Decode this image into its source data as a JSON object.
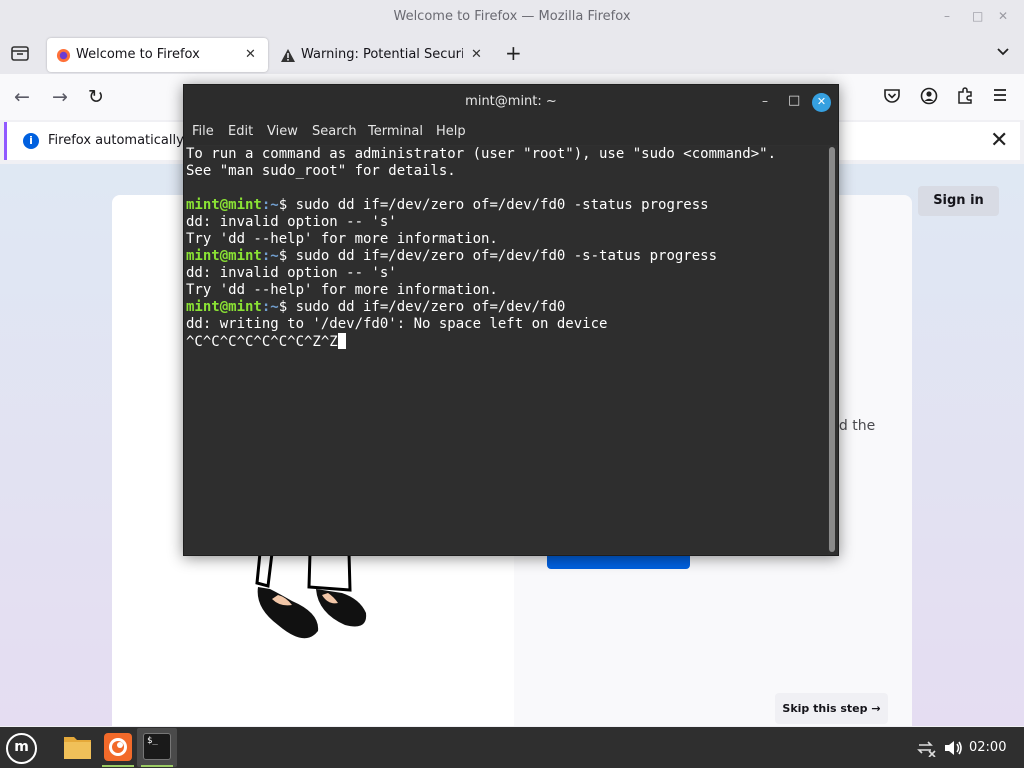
{
  "firefox": {
    "window_title": "Welcome to Firefox — Mozilla Firefox",
    "window_controls": {
      "minimize": "–",
      "maximize": "□",
      "close": "✕"
    },
    "tabs": [
      {
        "label": "Welcome to Firefox",
        "close": "✕",
        "active": true
      },
      {
        "label": "Warning: Potential Security",
        "close": "✕",
        "active": false
      }
    ],
    "new_tab_label": "+",
    "nav": {
      "back": "←",
      "forward": "→",
      "reload": "↻"
    },
    "notice": {
      "text": "Firefox automatically se",
      "info_glyph": "i",
      "close": "✕"
    },
    "page": {
      "sign_in": "Sign in",
      "body_peek": "nd the",
      "skip_button": "Skip this step →"
    }
  },
  "terminal": {
    "title": "mint@mint: ~",
    "controls": {
      "minimize": "–",
      "maximize": "□",
      "close": "✕"
    },
    "menu": [
      "File",
      "Edit",
      "View",
      "Search",
      "Terminal",
      "Help"
    ],
    "prompt": {
      "user": "mint@mint",
      "path": ":~",
      "symbol": "$ "
    },
    "lines": [
      {
        "text": "To run a command as administrator (user \"root\"), use \"sudo <command>\"."
      },
      {
        "text": "See \"man sudo_root\" for details."
      },
      {
        "text": ""
      },
      {
        "cmd": "sudo dd if=/dev/zero of=/dev/fd0 -status progress"
      },
      {
        "text": "dd: invalid option -- 's'"
      },
      {
        "text": "Try 'dd --help' for more information."
      },
      {
        "cmd": "sudo dd if=/dev/zero of=/dev/fd0 -s-tatus progress"
      },
      {
        "text": "dd: invalid option -- 's'"
      },
      {
        "text": "Try 'dd --help' for more information."
      },
      {
        "cmd": "sudo dd if=/dev/zero of=/dev/fd0"
      },
      {
        "text": "dd: writing to '/dev/fd0': No space left on device"
      },
      {
        "text": "^C^C^C^C^C^C^C^Z^Z",
        "cursor": true
      }
    ]
  },
  "taskbar": {
    "menu_glyph": "m",
    "apps": [
      {
        "name": "files",
        "icon": "folder-icon"
      },
      {
        "name": "firefox",
        "icon": "firefox-icon"
      },
      {
        "name": "terminal",
        "icon": "terminal-icon",
        "glyph": "$_"
      }
    ],
    "clock": "02:00"
  }
}
